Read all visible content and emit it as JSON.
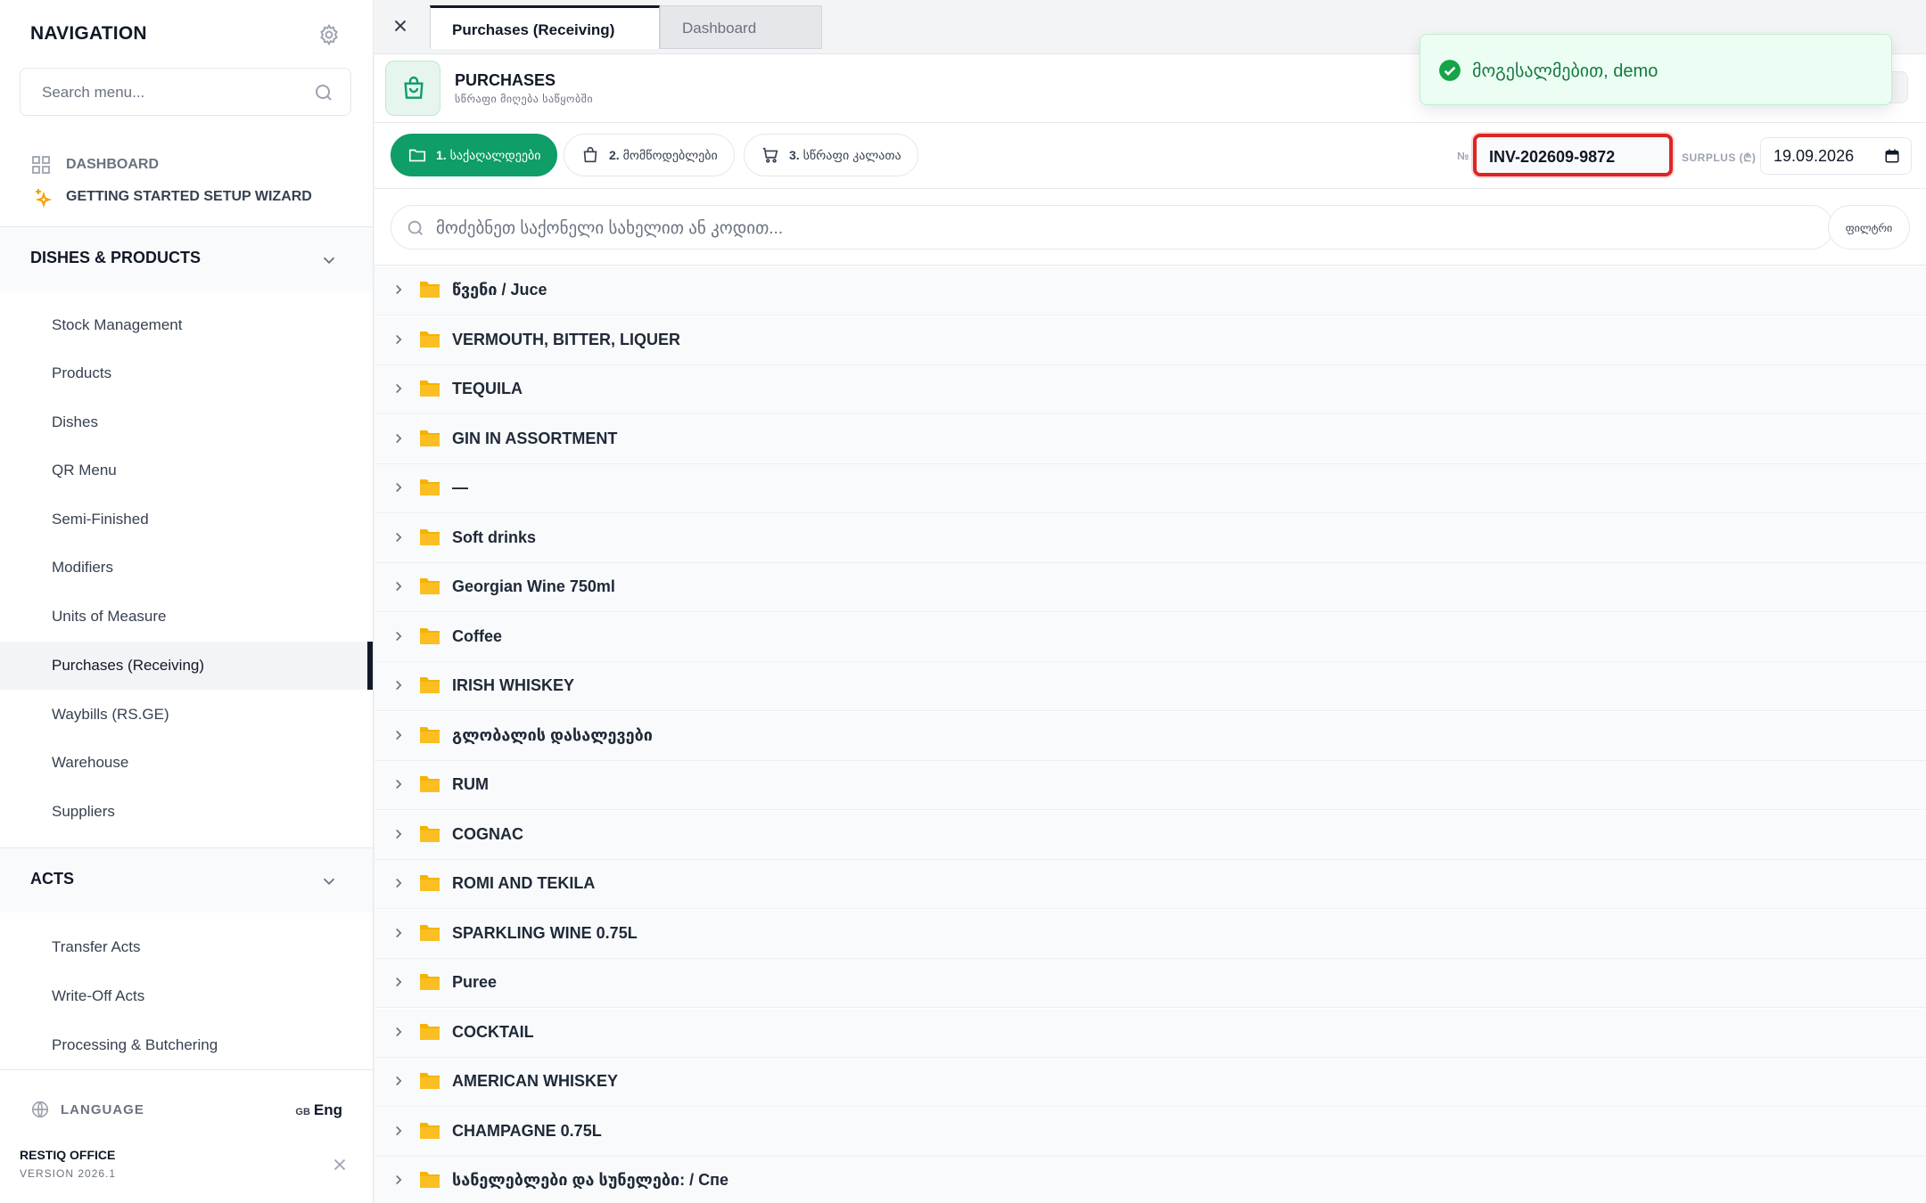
{
  "sidebar": {
    "title": "NAVIGATION",
    "search_placeholder": "Search menu...",
    "top_links": [
      {
        "label": "DASHBOARD",
        "icon": "grid-icon"
      },
      {
        "label": "GETTING STARTED SETUP WIZARD",
        "icon": "sparkle-icon"
      }
    ],
    "sections": [
      {
        "label": "DISHES & PRODUCTS",
        "expanded": true,
        "items": [
          "Stock Management",
          "Products",
          "Dishes",
          "QR Menu",
          "Semi-Finished",
          "Modifiers",
          "Units of Measure",
          "Purchases (Receiving)",
          "Waybills (RS.GE)",
          "Warehouse",
          "Suppliers"
        ]
      },
      {
        "label": "ACTS",
        "expanded": true,
        "items": [
          "Transfer Acts",
          "Write-Off Acts",
          "Processing & Butchering"
        ]
      }
    ],
    "active_item": "Purchases (Receiving)",
    "language": {
      "label": "LANGUAGE",
      "flag": "GB",
      "value": "Eng"
    },
    "app_name": "RESTIQ OFFICE",
    "version": "VERSION 2026.1"
  },
  "tabs": [
    {
      "label": "Purchases (Receiving)",
      "active": true
    },
    {
      "label": "Dashboard",
      "active": false
    }
  ],
  "page": {
    "title": "PURCHASES",
    "subtitle": "სწრაფი მიღება საწყობში",
    "icon": "shopping-bag-icon"
  },
  "steps": [
    {
      "num": "1.",
      "label": "საქაღალდეები",
      "icon": "folder-icon",
      "active": true
    },
    {
      "num": "2.",
      "label": "მომწოდებლები",
      "icon": "bag-icon",
      "active": false
    },
    {
      "num": "3.",
      "label": "სწრაფი კალათა",
      "icon": "cart-icon",
      "active": false
    }
  ],
  "invoice": {
    "no_label": "№",
    "value": "INV-202609-9872"
  },
  "surplus": {
    "label": "SURPLUS (₾)",
    "date": "19.09.2026"
  },
  "goods_search": {
    "placeholder": "მოძებნეთ საქონელი სახელით ან კოდით...",
    "filter_label": "ფილტრი"
  },
  "folders": [
    "წვენი / Juce",
    "VERMOUTH, BITTER, LIQUER",
    "TEQUILA",
    "GIN IN ASSORTMENT",
    "—",
    "Soft drinks",
    "Georgian Wine 750ml",
    "Coffee",
    "IRISH WHISKEY",
    "გლობალის დასალევები",
    "RUM",
    "COGNAC",
    "ROMI AND TEKILA",
    "SPARKLING WINE 0.75L",
    "Puree",
    "COCKTAIL",
    "AMERICAN WHISKEY",
    "CHAMPAGNE 0.75L",
    "სანელებლები და სუნელები: / Спе"
  ],
  "toast": {
    "message": "მოგესალმებით, demo",
    "color": "#147a3f"
  },
  "colors": {
    "accent": "#0f9d68",
    "highlight": "#dc2626",
    "folder": "#f5b301"
  }
}
